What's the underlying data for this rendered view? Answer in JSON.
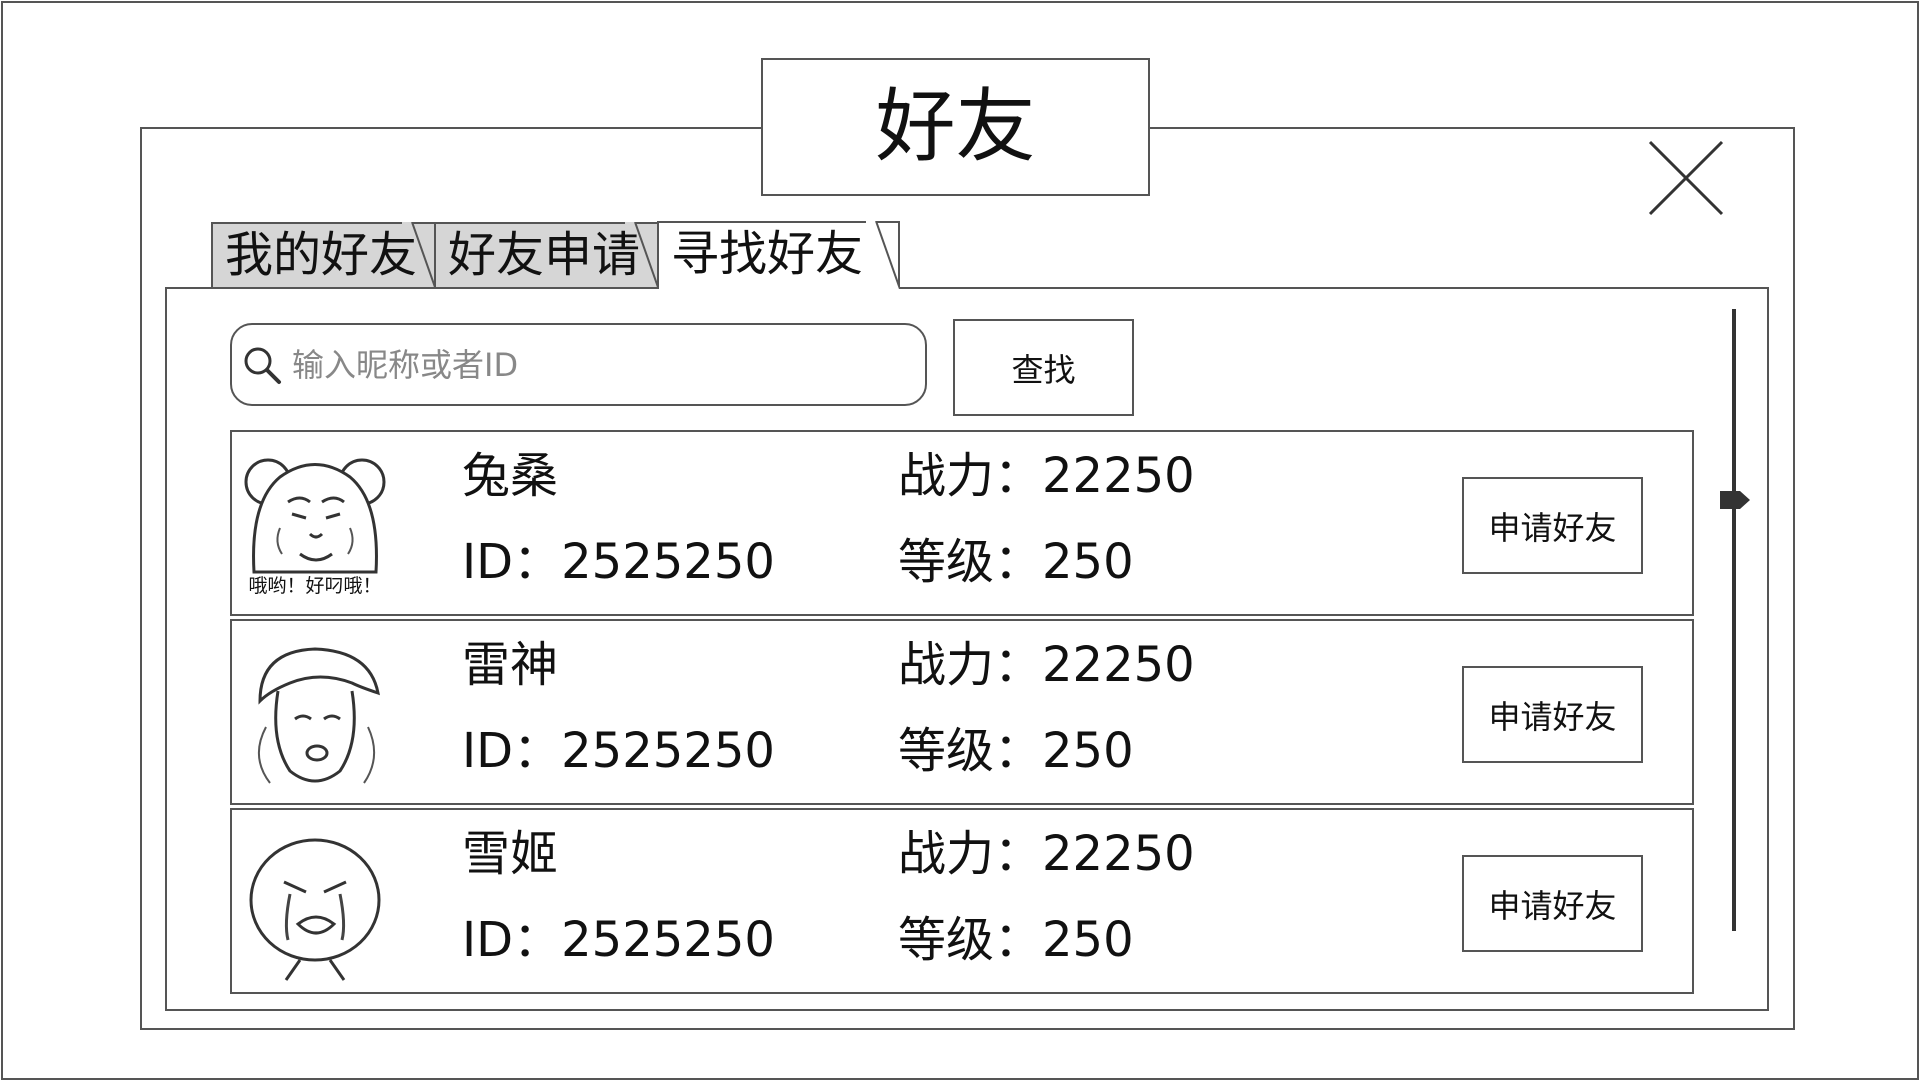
{
  "dialog": {
    "title": "好友",
    "close_icon": "close-icon"
  },
  "tabs": [
    {
      "label": "我的好友",
      "active": false
    },
    {
      "label": "好友申请",
      "active": false
    },
    {
      "label": "寻找好友",
      "active": true
    }
  ],
  "search": {
    "placeholder": "输入昵称或者ID",
    "value": "",
    "icon": "search-icon",
    "button_label": "查找"
  },
  "results": [
    {
      "name": "兔桑",
      "id": "ID：2525250",
      "power": "战力：22250",
      "level": "等级：250",
      "avatar_caption": "哦哟！好叼哦！",
      "button_label": "申请好友"
    },
    {
      "name": "雷神",
      "id": "ID：2525250",
      "power": "战力：22250",
      "level": "等级：250",
      "button_label": "申请好友"
    },
    {
      "name": "雪姬",
      "id": "ID：2525250",
      "power": "战力：22250",
      "level": "等级：250",
      "button_label": "申请好友"
    }
  ],
  "colors": {
    "border": "#555555",
    "inactive_tab": "#d6d6d6",
    "background": "#ffffff"
  }
}
